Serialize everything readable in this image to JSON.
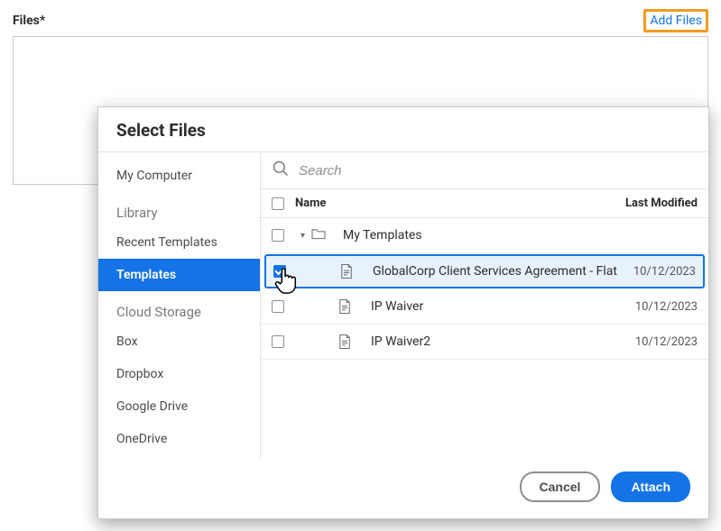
{
  "files_section": {
    "label": "Files*",
    "add_files_label": "Add Files"
  },
  "dialog": {
    "title": "Select Files",
    "sidebar": {
      "my_computer": "My Computer",
      "groups": [
        {
          "head": "Library",
          "items": [
            {
              "label": "Recent Templates",
              "active": false
            },
            {
              "label": "Templates",
              "active": true
            }
          ]
        },
        {
          "head": "Cloud Storage",
          "items": [
            {
              "label": "Box",
              "active": false
            },
            {
              "label": "Dropbox",
              "active": false
            },
            {
              "label": "Google Drive",
              "active": false
            },
            {
              "label": "OneDrive",
              "active": false
            }
          ]
        }
      ]
    },
    "search_placeholder": "Search",
    "columns": {
      "name": "Name",
      "modified": "Last Modified"
    },
    "folder": {
      "name": "My Templates"
    },
    "files": [
      {
        "name": "GlobalCorp Client Services Agreement - Flat",
        "modified": "10/12/2023",
        "selected": true
      },
      {
        "name": "IP Waiver",
        "modified": "10/12/2023",
        "selected": false
      },
      {
        "name": "IP Waiver2",
        "modified": "10/12/2023",
        "selected": false
      }
    ],
    "buttons": {
      "cancel": "Cancel",
      "attach": "Attach"
    }
  }
}
